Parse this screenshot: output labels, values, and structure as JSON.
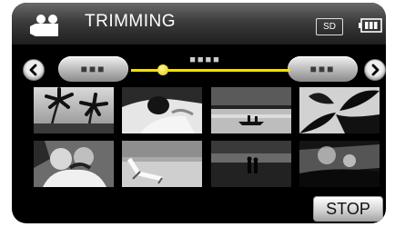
{
  "header": {
    "mode_icon": "movie-camera-icon",
    "title": "TRIMMING",
    "media_badge": "SD",
    "battery_icon": "battery-icon"
  },
  "navigation": {
    "prev_icon": "chevron-left-icon",
    "next_icon": "chevron-right-icon",
    "start_label": "■■■",
    "end_label": "■■■",
    "counter": "■■■■",
    "playback_position": 0.2
  },
  "thumbnails": [
    {
      "scene": "palm-trees"
    },
    {
      "scene": "woman-resting"
    },
    {
      "scene": "canoe-at-dusk"
    },
    {
      "scene": "leaf-silhouette"
    },
    {
      "scene": "couple-embracing"
    },
    {
      "scene": "beach-lounger"
    },
    {
      "scene": "couple-on-shore"
    },
    {
      "scene": "ocean-sparkle"
    }
  ],
  "actions": {
    "stop_label": "STOP"
  }
}
